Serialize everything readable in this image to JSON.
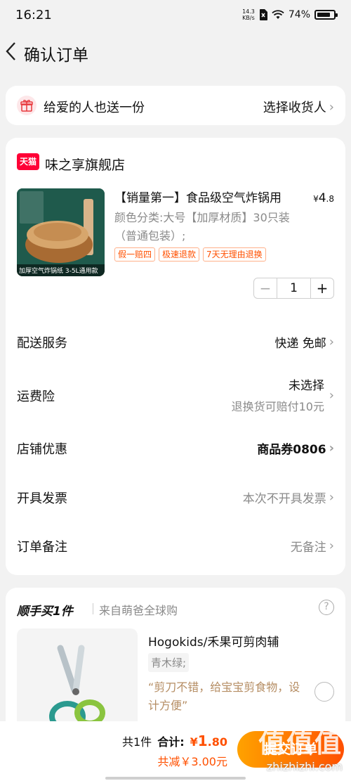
{
  "status_bar": {
    "time": "16:21",
    "net_speed_value": "14.3",
    "net_speed_unit": "KB/s",
    "battery": "74%"
  },
  "nav": {
    "title": "确认订单"
  },
  "gift": {
    "label": "给爱的人也送一份",
    "action": "选择收货人"
  },
  "shop": {
    "badge": "天猫",
    "name": "味之享旗舰店"
  },
  "product": {
    "title": "【销量第一】食品级空气炸锅用",
    "price_symbol": "¥",
    "price_int": "4",
    "price_dec": ".8",
    "variant": "颜色分类:大号【加厚材质】30只装（普通包装）;",
    "tags": [
      "假一赔四",
      "极速退款",
      "7天无理由退换"
    ],
    "image_caption": "加厚空气炸锅纸 3-5L通用款",
    "quantity": "1"
  },
  "rows": {
    "delivery": {
      "label": "配送服务",
      "value": "快递 免邮"
    },
    "insurance": {
      "label": "运费险",
      "value": "未选择",
      "sub": "退换货可赔付10元"
    },
    "coupon": {
      "label": "店铺优惠",
      "value": "商品券0806"
    },
    "invoice": {
      "label": "开具发票",
      "value": "本次不开具发票"
    },
    "note": {
      "label": "订单备注",
      "value": "无备注"
    }
  },
  "also_buy": {
    "heading": "顺手买1件",
    "source": "来自萌爸全球购",
    "title": "Hogokids/禾果可剪肉辅",
    "variant": "青木绿;",
    "quote": "“剪刀不错，给宝宝剪食物，设计方便”"
  },
  "bottom": {
    "count": "共1件",
    "total_label": "合计:",
    "total_symbol": "¥",
    "total_int": "1",
    "total_dec": ".80",
    "discount": "共减￥3.00元",
    "submit": "提交订单",
    "watermark": "值值值",
    "watermark_url": "zhizhizhi.com"
  },
  "colors": {
    "accent": "#ff5000",
    "tmall": "#ff0036"
  },
  "icons": {
    "back": "chevron-left-icon",
    "gift": "gift-icon",
    "help": "question-icon"
  }
}
